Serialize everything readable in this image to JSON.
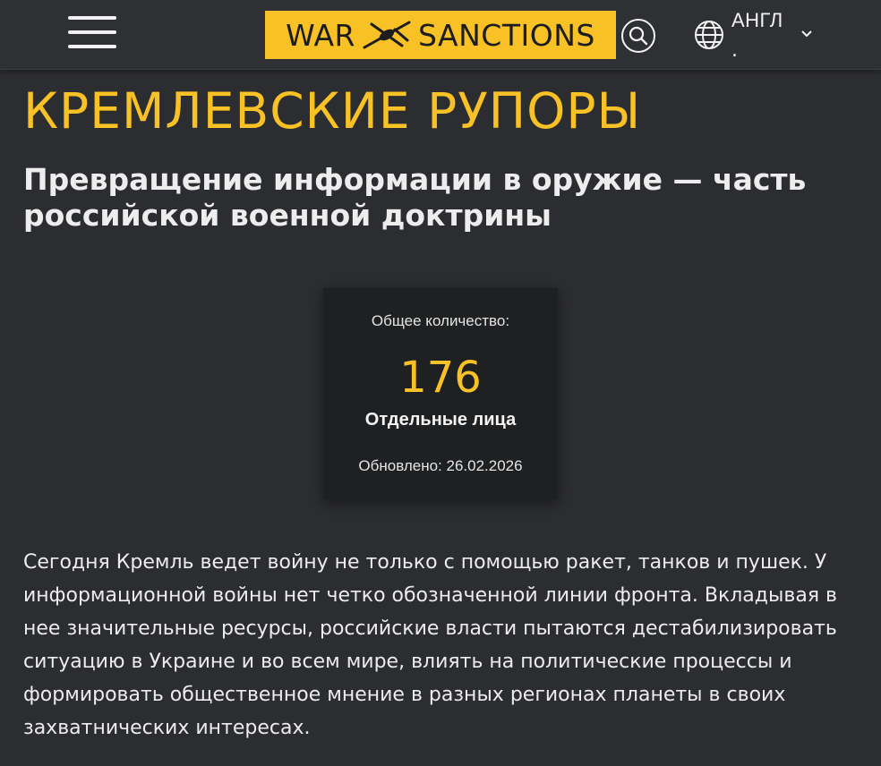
{
  "header": {
    "menu_icon": "hamburger-menu-icon",
    "logo": {
      "left": "WAR",
      "right": "SANCTIONS",
      "icon": "drone-icon"
    },
    "search_icon": "search-icon",
    "language": {
      "icon": "globe-icon",
      "label": "АНГЛ",
      "suffix": ".",
      "chevron": "chevron-down-icon"
    }
  },
  "main": {
    "title": "КРЕМЛЕВСКИЕ РУПОРЫ",
    "subtitle": "Превращение информации в оружие — часть российской военной доктрины",
    "stat": {
      "caption": "Общее количество:",
      "value": "176",
      "unit": "Отдельные лица",
      "updated": "Обновлено: 26.02.2026"
    },
    "description": "Сегодня Кремль ведет войну не только с помощью ракет, танков и пушек. У информационной войны нет четко обозначенной линии фронта. Вкладывая в нее значительные ресурсы, российские власти пытаются дестабилизировать ситуацию в Украине и во всем мире, влиять на политические процессы и формировать общественное мнение в разных регионах планеты в своих захватнических интересах."
  },
  "colors": {
    "accent": "#f8c126",
    "background": "#2c2d30",
    "card": "#1f2022",
    "text": "#ececec"
  }
}
